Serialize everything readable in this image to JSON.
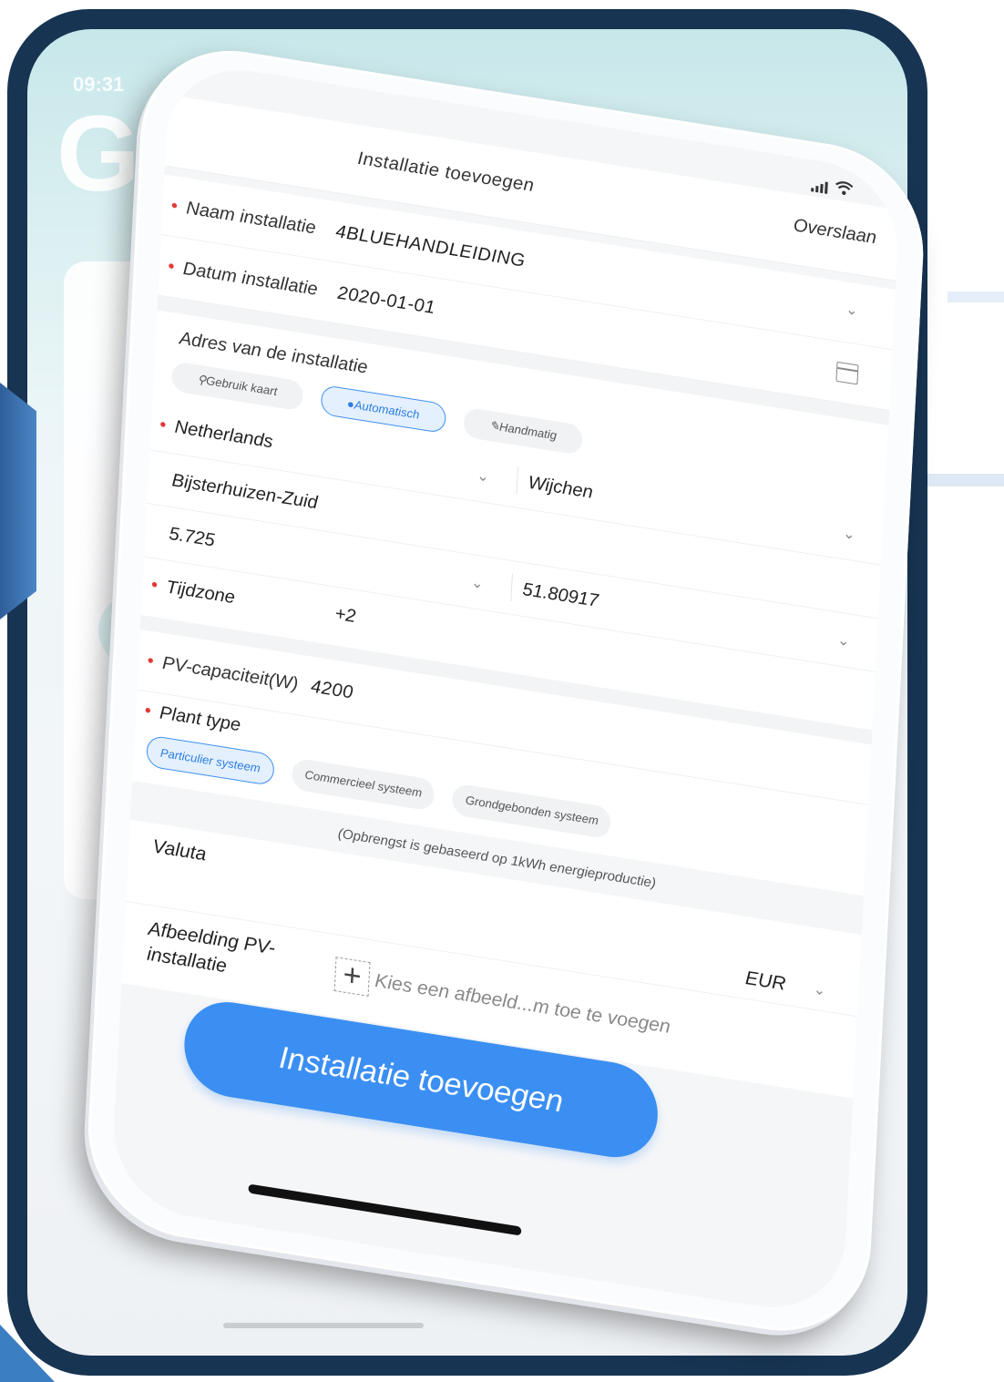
{
  "back": {
    "time": "09:31",
    "logo": "Growatt"
  },
  "status": {
    "signal_icon": "signal-icon",
    "wifi_icon": "wifi-icon"
  },
  "header": {
    "title": "Installatie toevoegen",
    "skip": "Overslaan"
  },
  "form": {
    "name": {
      "label": "Naam installatie",
      "value": "4BLUEHANDLEIDING"
    },
    "date": {
      "label": "Datum installatie",
      "value": "2020-01-01",
      "icon": "calendar-icon"
    },
    "address": {
      "title": "Adres van de installatie",
      "modes": [
        "Gebruik kaart",
        "Automatisch",
        "Handmatig"
      ],
      "active_mode": "Automatisch",
      "country": "Netherlands",
      "city": "Wijchen",
      "street": "Bijsterhuizen-Zuid",
      "longitude": "5.725",
      "latitude": "51.80917"
    },
    "timezone": {
      "label": "Tijdzone",
      "value": "+2"
    },
    "pv_capacity": {
      "label": "PV-capaciteit(W)",
      "value": "4200"
    },
    "plant_type": {
      "label": "Plant type",
      "options": [
        "Particulier systeem",
        "Commercieel systeem",
        "Grondgebonden systeem"
      ],
      "selected": "Particulier systeem"
    },
    "note": "(Opbrengst is gebaseerd op 1kWh energieproductie)",
    "currency": {
      "label": "Valuta",
      "value": "EUR"
    },
    "image": {
      "label": "Afbeelding PV-installatie",
      "hint": "Kies een afbeeld...m toe te voegen",
      "add_symbol": "+"
    }
  },
  "submit_label": "Installatie toevoegen",
  "colors": {
    "accent": "#3b8ff2",
    "required": "#e53935",
    "back_frame": "#173452"
  }
}
